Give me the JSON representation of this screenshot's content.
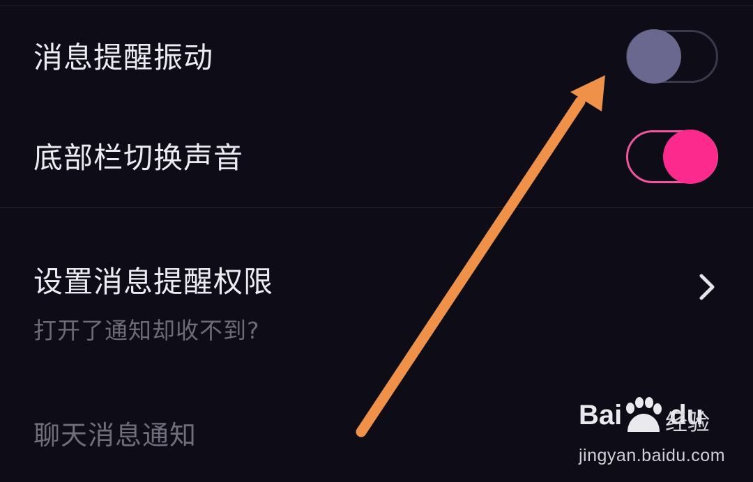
{
  "settings": {
    "vibration": {
      "label": "消息提醒振动",
      "enabled": false
    },
    "tab_sound": {
      "label": "底部栏切换声音",
      "enabled": true
    },
    "permission": {
      "label": "设置消息提醒权限",
      "subtitle": "打开了通知却收不到?"
    },
    "chat_section_title": "聊天消息通知"
  },
  "watermark": {
    "brand_left": "Bai",
    "brand_right": "du",
    "product": "经验",
    "url": "jingyan.baidu.com"
  },
  "colors": {
    "background": "#0e0d17",
    "toggle_on": "#fd2a8e",
    "toggle_off_knob": "#6b6890",
    "annotation_arrow": "#f0914a"
  },
  "icons": {
    "chevron": "chevron-right-icon",
    "arrow": "annotation-arrow-icon",
    "paw": "baidu-paw-icon"
  }
}
